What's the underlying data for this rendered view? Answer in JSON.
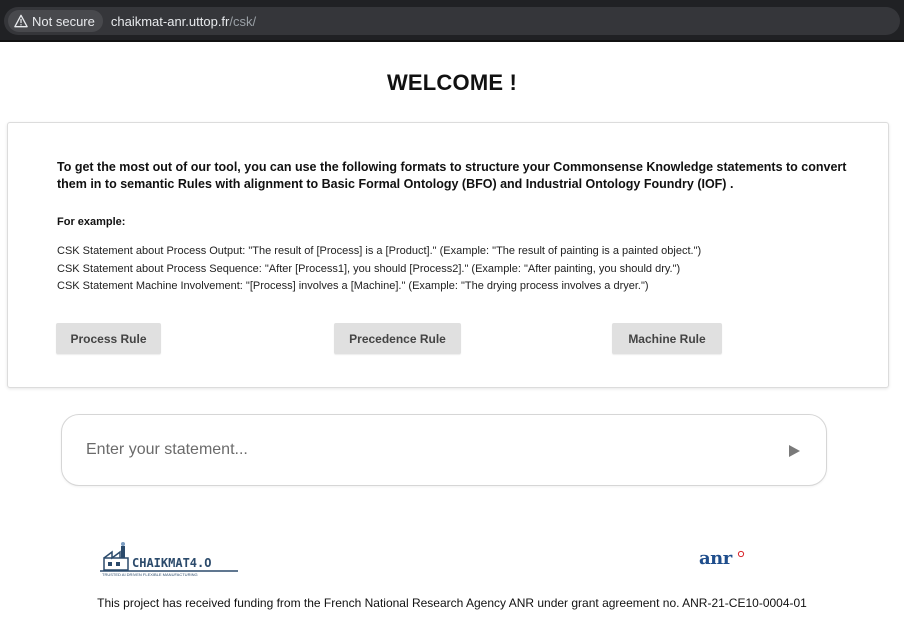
{
  "browser": {
    "security_label": "Not secure",
    "url_host": "chaikmat-anr.uttop.fr",
    "url_path": "/csk/"
  },
  "page": {
    "title": "WELCOME !",
    "intro": "To get the most out of our tool, you can use the following formats to structure your Commonsense Knowledge statements to convert them in to semantic Rules with alignment to Basic Formal Ontology (BFO) and Industrial Ontology Foundry (IOF) .",
    "example_label": "For example:",
    "examples": [
      "CSK Statement about Process Output: \"The result of [Process] is a [Product].\" (Example: \"The result of painting is a painted object.\")",
      "CSK Statement about Process Sequence: \"After [Process1], you should [Process2].\" (Example: \"After painting, you should dry.\")",
      "CSK Statement Machine Involvement: \"[Process] involves a [Machine].\" (Example: \"The drying process involves a dryer.\")"
    ],
    "buttons": {
      "process": "Process Rule",
      "precedence": "Precedence Rule",
      "machine": "Machine Rule"
    },
    "statement": {
      "placeholder": "Enter your statement...",
      "value": ""
    }
  },
  "footer": {
    "chaikmat_logo_text": "CHAIKMAT4.O",
    "chaikmat_tagline": "TRUSTED AI DRIVEN FLEXIBLE MANUFACTURING",
    "anr_logo_text": "anr",
    "funding_text": "This project has received funding from the French National Research Agency ANR under grant agreement no. ANR-21-CE10-0004-01"
  },
  "icons": {
    "warning": "warning-triangle-icon",
    "send": "send-arrow-icon"
  },
  "colors": {
    "button_bg": "#e0e0e0",
    "anr_blue": "#1f4e8c",
    "anr_red": "#d9262c"
  }
}
